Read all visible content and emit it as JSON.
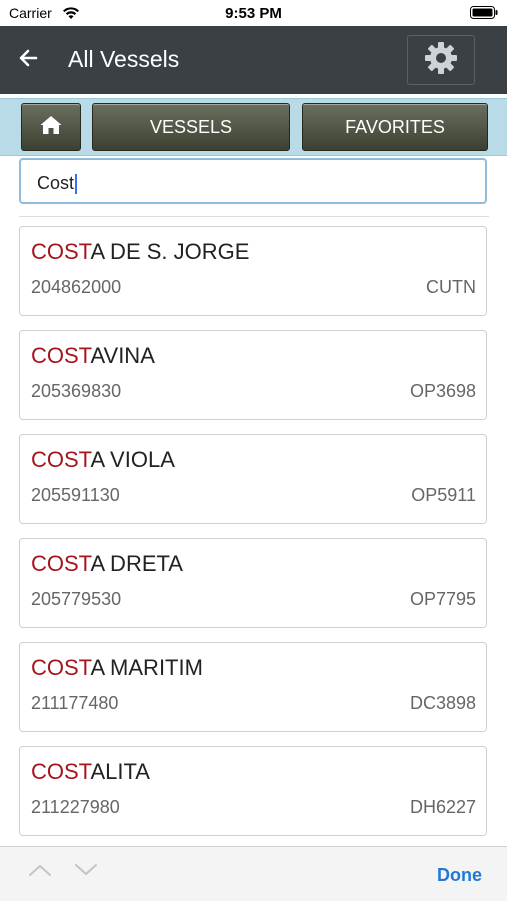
{
  "status_bar": {
    "carrier": "Carrier",
    "time": "9:53 PM"
  },
  "nav": {
    "title": "All Vessels",
    "back_icon": "back-arrow-icon",
    "settings_icon": "gear-icon"
  },
  "tabs": {
    "home_icon": "home-icon",
    "vessels_label": "VESSELS",
    "favorites_label": "FAVORITES"
  },
  "search": {
    "value": "Cost"
  },
  "vessels": [
    {
      "highlight": "COST",
      "rest": "A DE S. JORGE",
      "mmsi": "204862000",
      "callsign": "CUTN"
    },
    {
      "highlight": "COST",
      "rest": "AVINA",
      "mmsi": "205369830",
      "callsign": "OP3698"
    },
    {
      "highlight": "COST",
      "rest": "A VIOLA",
      "mmsi": "205591130",
      "callsign": "OP5911"
    },
    {
      "highlight": "COST",
      "rest": "A DRETA",
      "mmsi": "205779530",
      "callsign": "OP7795"
    },
    {
      "highlight": "COST",
      "rest": "A MARITIM",
      "mmsi": "211177480",
      "callsign": "DC3898"
    },
    {
      "highlight": "COST",
      "rest": "ALITA",
      "mmsi": "211227980",
      "callsign": "DH6227"
    }
  ],
  "keyboard_bar": {
    "done_label": "Done"
  },
  "colors": {
    "nav_bg": "#3b4045",
    "tab_strip_bg": "#b9dbe8",
    "highlight_red": "#a8141e",
    "done_blue": "#1f7ad6"
  }
}
